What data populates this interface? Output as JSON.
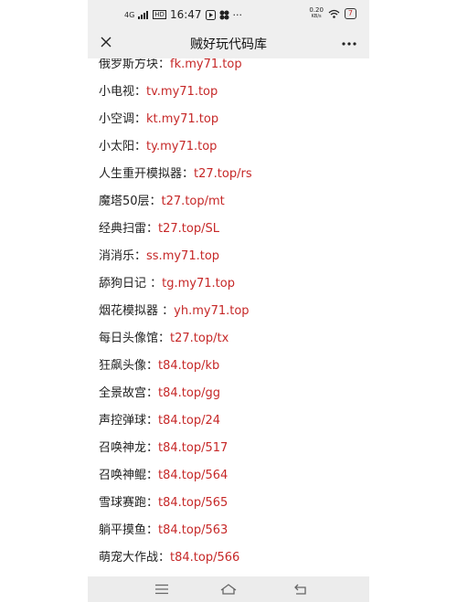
{
  "status": {
    "signal": "4G",
    "time": "16:47",
    "hd": "HD",
    "dots": "···",
    "speed": "0.20",
    "speed_unit": "KB/s",
    "battery": "7"
  },
  "header": {
    "title": "贼好玩代码库"
  },
  "rows": [
    {
      "name": "俄罗斯方块：",
      "url": "fk.my71.top"
    },
    {
      "name": "小电视：",
      "url": "tv.my71.top"
    },
    {
      "name": "小空调：",
      "url": "kt.my71.top"
    },
    {
      "name": "小太阳：",
      "url": "ty.my71.top"
    },
    {
      "name": "人生重开模拟器：",
      "url": "t27.top/rs"
    },
    {
      "name": "魔塔50层：",
      "url": "t27.top/mt"
    },
    {
      "name": "经典扫雷：",
      "url": "t27.top/SL"
    },
    {
      "name": "消消乐：",
      "url": "ss.my71.top"
    },
    {
      "name": "舔狗日记 ：",
      "url": "tg.my71.top"
    },
    {
      "name": "烟花模拟器 ：",
      "url": "yh.my71.top"
    },
    {
      "name": "每日头像馆：",
      "url": "t27.top/tx"
    },
    {
      "name": "狂飙头像：",
      "url": "t84.top/kb"
    },
    {
      "name": "全景故宫：",
      "url": "t84.top/gg"
    },
    {
      "name": "声控弹球：",
      "url": "t84.top/24"
    },
    {
      "name": "召唤神龙：",
      "url": "t84.top/517"
    },
    {
      "name": "召唤神鲲：",
      "url": "t84.top/564"
    },
    {
      "name": "雪球赛跑：",
      "url": "t84.top/565"
    },
    {
      "name": "躺平摸鱼：",
      "url": "t84.top/563"
    },
    {
      "name": "萌宠大作战：",
      "url": "t84.top/566"
    }
  ]
}
